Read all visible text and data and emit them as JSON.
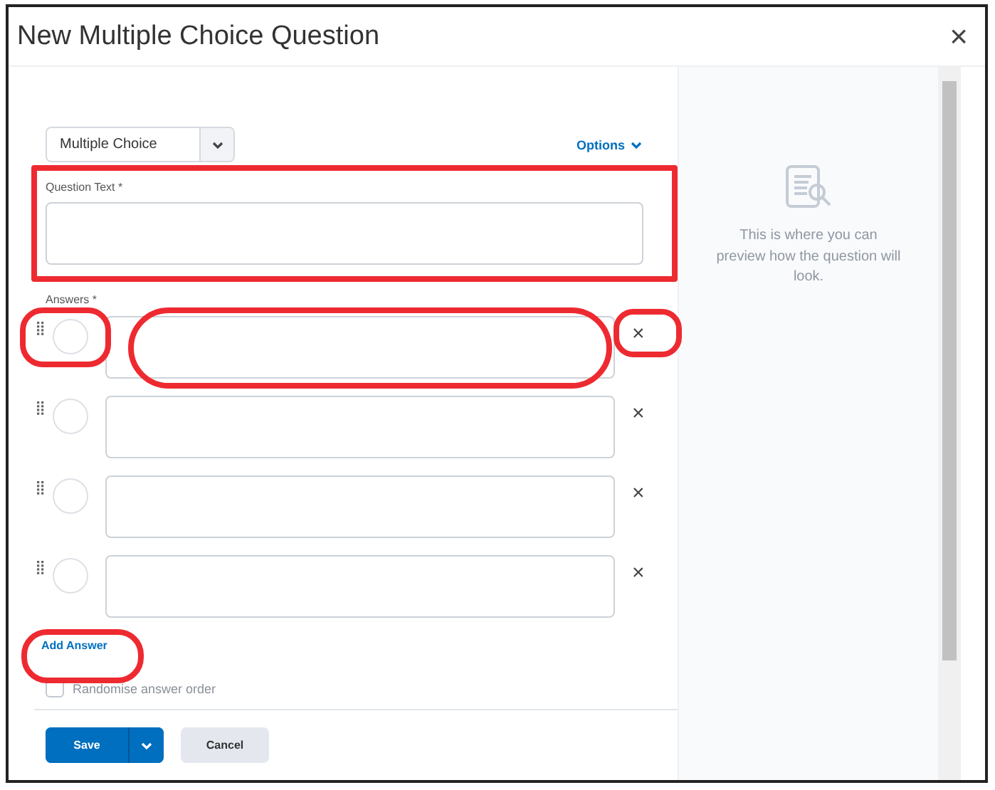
{
  "dialog": {
    "title": "New Multiple Choice Question",
    "close": "×"
  },
  "question_type": {
    "value": "Multiple Choice"
  },
  "options_link": "Options",
  "question_text": {
    "label": "Question Text *"
  },
  "answers_label": "Answers *",
  "answers": [
    {
      "selected": false,
      "remove": "×"
    },
    {
      "selected": false,
      "remove": "×"
    },
    {
      "selected": false,
      "remove": "×"
    },
    {
      "selected": false,
      "remove": "×"
    }
  ],
  "add_answer": "Add Answer",
  "randomise": {
    "label": "Randomise answer order",
    "checked": false
  },
  "preview": {
    "text": "This is where you can preview how the question will look."
  },
  "buttons": {
    "save": "Save",
    "cancel": "Cancel"
  }
}
